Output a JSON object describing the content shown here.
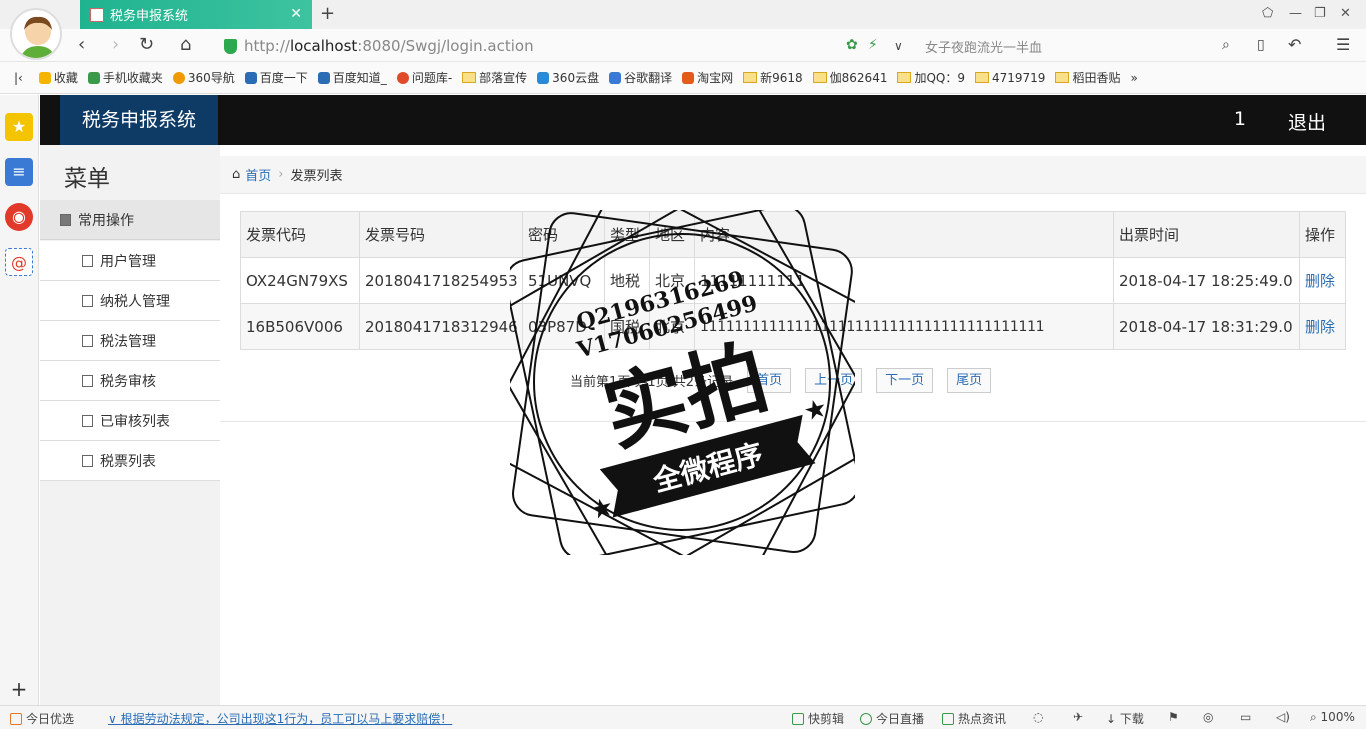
{
  "browser": {
    "tab_title": "税务申报系统",
    "url_prefix": "http://",
    "url_host": "localhost",
    "url_rest": ":8080/Swgj/login.action",
    "search_hint": "女子夜跑流光一半血",
    "bookmarks": [
      "收藏",
      "手机收藏夹",
      "360导航",
      "百度一下",
      "百度知道_",
      "问题库-",
      "部落宣传",
      "360云盘",
      "谷歌翻译",
      "淘宝网",
      "新9618",
      "伽862641",
      "加QQ：9",
      "4719719",
      "稻田香贴"
    ]
  },
  "header": {
    "brand": "税务申报系统",
    "user": "1",
    "logout": "退出"
  },
  "sidebar": {
    "title": "菜单",
    "group": "常用操作",
    "items": [
      {
        "label": "用户管理"
      },
      {
        "label": "纳税人管理"
      },
      {
        "label": "税法管理"
      },
      {
        "label": "税务审核"
      },
      {
        "label": "已审核列表"
      },
      {
        "label": "税票列表"
      }
    ]
  },
  "breadcrumb": {
    "home": "首页",
    "current": "发票列表"
  },
  "table": {
    "headers": [
      "发票代码",
      "发票号码",
      "密码",
      "类型",
      "地区",
      "内容",
      "出票时间",
      "操作"
    ],
    "rows": [
      {
        "code": "OX24GN79XS",
        "number": "2018041718254953",
        "password": "51UNVQ",
        "type": "地税",
        "region": "北京",
        "content": "11111111111",
        "time": "2018-04-17 18:25:49.0",
        "action": "删除"
      },
      {
        "code": "16B506V006",
        "number": "2018041718312946",
        "password": "03P87D",
        "type": "国税",
        "region": "北京",
        "content": "1111111111111111111111111111111111111111",
        "time": "2018-04-17 18:31:29.0",
        "action": "删除"
      }
    ]
  },
  "pager": {
    "info": "当前第1页 共1页 共2条记录",
    "first": "首页",
    "prev": "上一页",
    "next": "下一页",
    "last": "尾页"
  },
  "watermark": {
    "line1": "Q2196316269",
    "line2": "V17060256499",
    "big": "实拍",
    "ribbon": "全微程序"
  },
  "statusbar": {
    "left": "今日优选",
    "news": "根据劳动法规定，公司出现这1行为，员工可以马上要求赔偿！",
    "items": [
      "快剪辑",
      "今日直播",
      "热点资讯",
      "下载"
    ],
    "zoom": "100%"
  }
}
